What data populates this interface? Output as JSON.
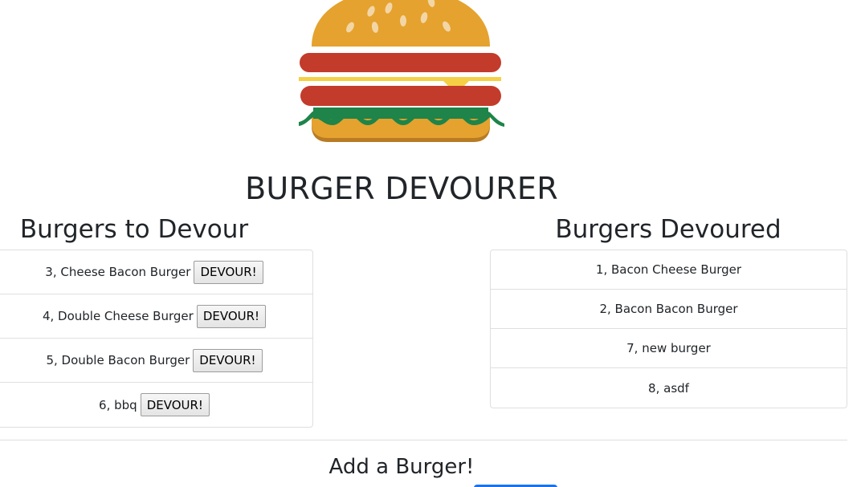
{
  "app": {
    "title": "BURGER DEVOURER",
    "logo_icon": "burger-icon"
  },
  "to_devour": {
    "title": "Burgers to Devour",
    "button_label": "DEVOUR!",
    "items": [
      {
        "label": "3, Cheese Bacon Burger"
      },
      {
        "label": "4, Double Cheese Burger"
      },
      {
        "label": "5, Double Bacon Burger"
      },
      {
        "label": "6, bbq"
      }
    ]
  },
  "devoured": {
    "title": "Burgers Devoured",
    "items": [
      {
        "label": "1, Bacon Cheese Burger"
      },
      {
        "label": "2, Bacon Bacon Burger"
      },
      {
        "label": "7, new burger"
      },
      {
        "label": "8, asdf"
      }
    ]
  },
  "add_form": {
    "title": "Add a Burger!"
  },
  "colors": {
    "bun": "#E5A22E",
    "sesame": "#F3D6A6",
    "meat": "#C33B2B",
    "cheese": "#F5D046",
    "lettuce": "#1E8449",
    "accent_blue": "#1a73e8"
  }
}
